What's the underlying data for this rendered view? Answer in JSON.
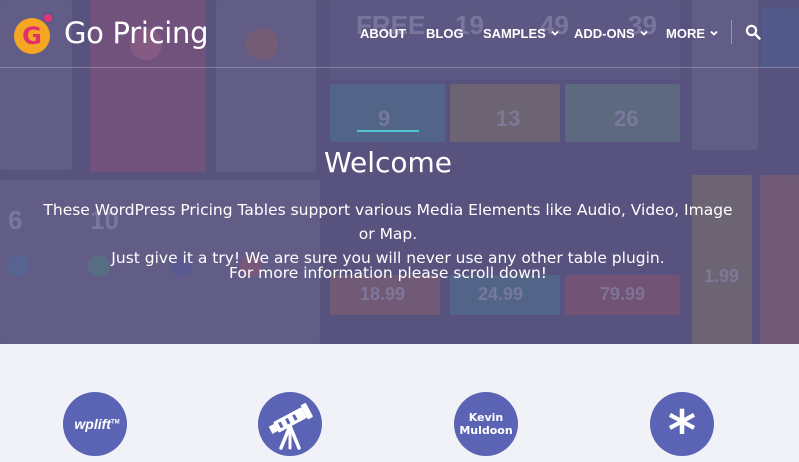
{
  "brand": {
    "logo_letter": "G",
    "name": "Go Pricing"
  },
  "nav": {
    "items": [
      {
        "label": "ABOUT",
        "has_dropdown": false
      },
      {
        "label": "BLOG",
        "has_dropdown": false
      },
      {
        "label": "SAMPLES",
        "has_dropdown": true
      },
      {
        "label": "ADD-ONS",
        "has_dropdown": true
      },
      {
        "label": "MORE",
        "has_dropdown": true
      }
    ],
    "search_icon": "search-icon"
  },
  "hero": {
    "title": "Welcome",
    "intro_line1": "These WordPress Pricing Tables support various Media Elements like Audio, Video, Image or Map.",
    "intro_line2": "Just give it a try! We are sure you will never use any other table plugin.",
    "more_info": "For more information please scroll down!",
    "background_prices": [
      "FREE",
      "19",
      "49",
      "39",
      "9",
      "13",
      "26",
      "6",
      "10",
      "18.99",
      "24.99",
      "79.99",
      "1.99"
    ]
  },
  "features": [
    {
      "name": "wplift",
      "label": "wplift",
      "tm": "TM"
    },
    {
      "name": "telescope",
      "icon": "telescope-icon"
    },
    {
      "name": "kevin-muldoon",
      "line1": "Kevin",
      "line2": "Muldoon"
    },
    {
      "name": "asterisk",
      "icon": "asterisk-icon",
      "label": "*"
    }
  ],
  "colors": {
    "hero_bg": "#5d5a82",
    "accent_line": "#4ec3d4",
    "feature_circle": "#5b63b4",
    "page_bg": "#f1f2f7",
    "logo_orange": "#f5a623",
    "logo_pink": "#e6317a"
  }
}
